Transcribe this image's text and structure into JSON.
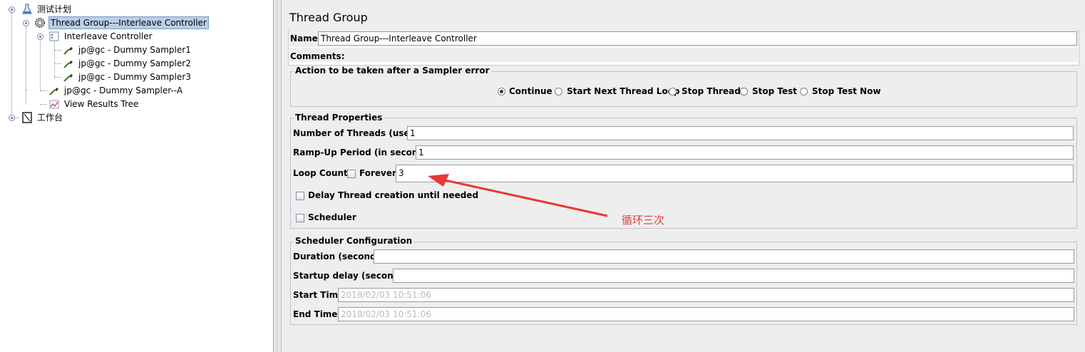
{
  "tree": {
    "items": [
      {
        "label": "测试计划",
        "icon": "flask-icon"
      },
      {
        "label": "Thread Group---Interleave Controller",
        "icon": "gear-icon",
        "selected": true
      },
      {
        "label": "Interleave Controller",
        "icon": "controller-icon"
      },
      {
        "label": "jp@gc - Dummy Sampler1",
        "icon": "pipette-icon"
      },
      {
        "label": "jp@gc - Dummy Sampler2",
        "icon": "pipette-icon"
      },
      {
        "label": "jp@gc - Dummy Sampler3",
        "icon": "pipette-icon"
      },
      {
        "label": "jp@gc - Dummy Sampler--A",
        "icon": "pipette-icon"
      },
      {
        "label": "View Results Tree",
        "icon": "chart-listener-icon"
      },
      {
        "label": "工作台",
        "icon": "workbench-icon"
      }
    ]
  },
  "panel": {
    "title": "Thread Group",
    "name_label": "Name:",
    "name_value": "Thread Group---Interleave Controller",
    "comments_label": "Comments:"
  },
  "action": {
    "title": "Action to be taken after a Sampler error",
    "options": [
      {
        "label": "Continue",
        "checked": true
      },
      {
        "label": "Start Next Thread Loop",
        "checked": false
      },
      {
        "label": "Stop Thread",
        "checked": false
      },
      {
        "label": "Stop Test",
        "checked": false
      },
      {
        "label": "Stop Test Now",
        "checked": false
      }
    ]
  },
  "thread_props": {
    "title": "Thread Properties",
    "threads_label": "Number of Threads (users):",
    "threads_value": "1",
    "rampup_label": "Ramp-Up Period (in seconds):",
    "rampup_value": "1",
    "loop_label": "Loop Count:",
    "forever_label": "Forever",
    "forever_checked": false,
    "loop_value": "3",
    "delay_label": "Delay Thread creation until needed",
    "delay_checked": false,
    "scheduler_label": "Scheduler",
    "scheduler_checked": false
  },
  "scheduler_config": {
    "title": "Scheduler Configuration",
    "duration_label": "Duration (seconds)",
    "duration_value": "",
    "startup_label": "Startup delay (seconds)",
    "startup_value": "",
    "start_label": "Start Time",
    "start_value": "2018/02/03 10:51:06",
    "end_label": "End Time",
    "end_value": "2018/02/03 10:51:06"
  },
  "annotation": {
    "text": "循环三次",
    "color": "#e53935"
  }
}
